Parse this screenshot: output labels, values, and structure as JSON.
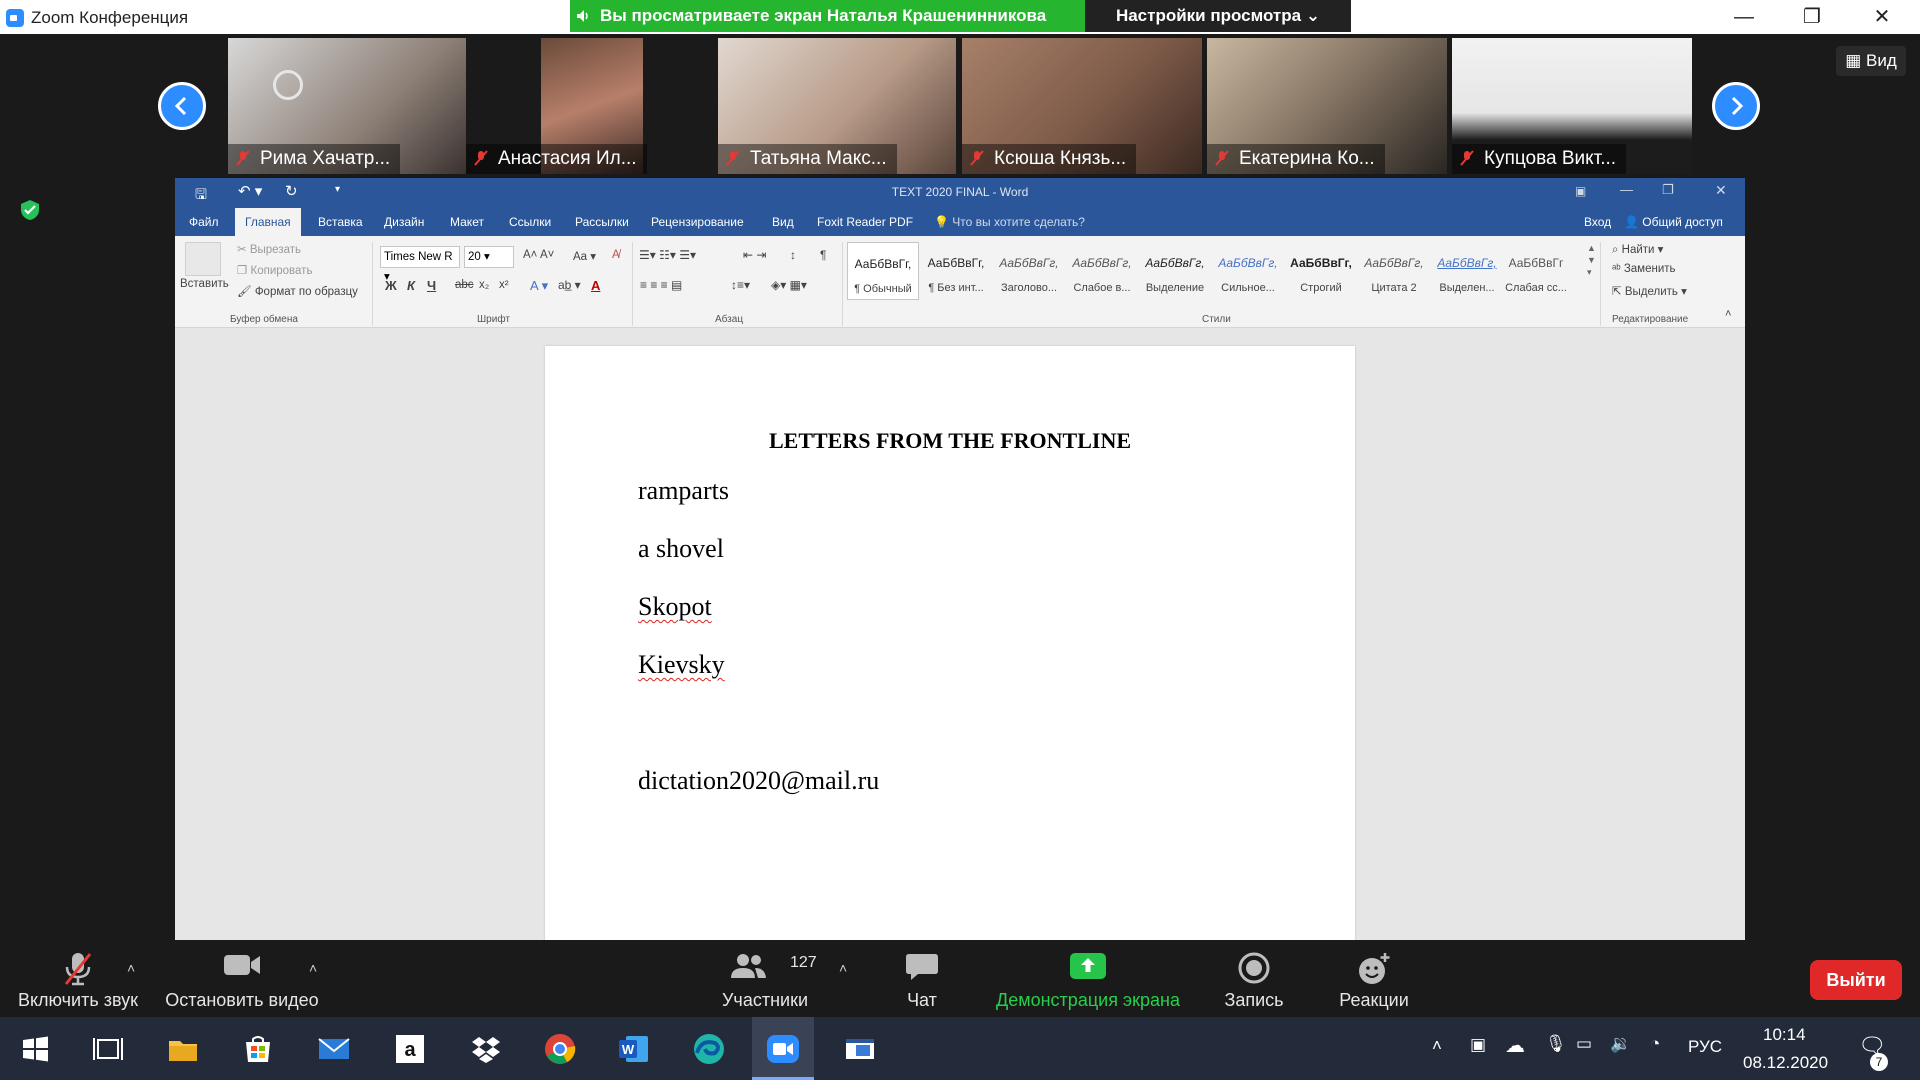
{
  "window": {
    "title": "Zoom Конференция",
    "minimize": "—",
    "restore": "❐",
    "close": "✕"
  },
  "share_banner": {
    "text": "Вы просматриваете экран Наталья Крашенинникова",
    "view_options": "Настройки просмотра ⌄"
  },
  "gallery": {
    "participants": [
      {
        "name": "Рима Хачатр...",
        "muted": true
      },
      {
        "name": "Анастасия Ил...",
        "muted": true
      },
      {
        "name": "Татьяна Макс...",
        "muted": true
      },
      {
        "name": "Ксюша Князь...",
        "muted": true
      },
      {
        "name": "Екатерина Ко...",
        "muted": true
      },
      {
        "name": "Купцова Викт...",
        "muted": true
      }
    ],
    "view_button": "Вид"
  },
  "word": {
    "title": "TEXT 2020 FINAL  -  Word",
    "tabs": [
      "Файл",
      "Главная",
      "Вставка",
      "Дизайн",
      "Макет",
      "Ссылки",
      "Рассылки",
      "Рецензирование",
      "Вид",
      "Foxit Reader PDF"
    ],
    "active_tab": "Главная",
    "tell_me": "Что вы хотите сделать?",
    "sign_in": "Вход",
    "share": "Общий доступ",
    "clipboard": {
      "paste": "Вставить",
      "cut": "Вырезать",
      "copy": "Копировать",
      "format_painter": "Формат по образцу",
      "label": "Буфер обмена"
    },
    "font": {
      "name": "Times New R",
      "size": "20",
      "label": "Шрифт",
      "case": "Aa",
      "bold": "Ж",
      "italic": "К",
      "underline": "Ч",
      "strike": "abc",
      "sub": "x₂",
      "sup": "x²"
    },
    "paragraph": {
      "label": "Абзац"
    },
    "styles": {
      "label": "Стили",
      "items": [
        {
          "preview": "АаБбВвГг,",
          "name": "¶ Обычный"
        },
        {
          "preview": "АаБбВвГг,",
          "name": "¶ Без инт..."
        },
        {
          "preview": "АаБбВвГг,",
          "name": "Заголово..."
        },
        {
          "preview": "АаБбВвГг,",
          "name": "Слабое в..."
        },
        {
          "preview": "АаБбВвГг,",
          "name": "Выделение"
        },
        {
          "preview": "АаБбВвГг,",
          "name": "Сильное..."
        },
        {
          "preview": "АаБбВвГг,",
          "name": "Строгий"
        },
        {
          "preview": "АаБбВвГг,",
          "name": "Цитата 2"
        },
        {
          "preview": "АаБбВвГг,",
          "name": "Выделен..."
        },
        {
          "preview": "АаБбВвГг",
          "name": "Слабая сс..."
        }
      ]
    },
    "editing": {
      "find": "Найти",
      "replace": "Заменить",
      "select": "Выделить",
      "label": "Редактирование"
    },
    "document": {
      "heading": "LETTERS FROM THE FRONTLINE",
      "lines": [
        "ramparts",
        "a shovel",
        "Skopot",
        "Kievsky"
      ],
      "email": "dictation2020@mail.ru"
    }
  },
  "toolbar": {
    "unmute": "Включить звук",
    "stop_video": "Остановить видео",
    "participants": "Участники",
    "participant_count": "127",
    "chat": "Чат",
    "share_screen": "Демонстрация экрана",
    "record": "Запись",
    "reactions": "Реакции",
    "leave": "Выйти"
  },
  "taskbar": {
    "language": "РУС",
    "time": "10:14",
    "date": "08.12.2020",
    "notifications": "7"
  },
  "colors": {
    "zoom_blue": "#2d8cff",
    "word_blue": "#2b579a",
    "share_green": "#26b52e",
    "leave_red": "#e02828"
  }
}
